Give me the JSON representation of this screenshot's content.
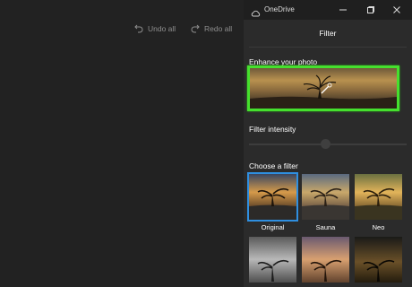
{
  "toolbar": {
    "undo_label": "Undo all",
    "redo_label": "Redo all"
  },
  "window": {
    "title": "OneDrive"
  },
  "panel": {
    "heading": "Filter",
    "enhance_label": "Enhance your photo",
    "intensity_label": "Filter intensity",
    "intensity_value": 0.5,
    "choose_label": "Choose a filter"
  },
  "filters": [
    {
      "label": "Original",
      "selected": true
    },
    {
      "label": "Sauna",
      "selected": false
    },
    {
      "label": "Neo",
      "selected": false
    },
    {
      "label": "",
      "selected": false
    },
    {
      "label": "",
      "selected": false
    },
    {
      "label": "",
      "selected": false
    }
  ],
  "colors": {
    "accent": "#45e02e",
    "selection": "#2f8fe0",
    "panel": "#2b2b2b",
    "canvas": "#222222"
  },
  "icons": [
    "undo-icon",
    "redo-icon",
    "onedrive-icon",
    "minimize-icon",
    "maximize-icon",
    "close-icon",
    "magic-wand-icon"
  ]
}
